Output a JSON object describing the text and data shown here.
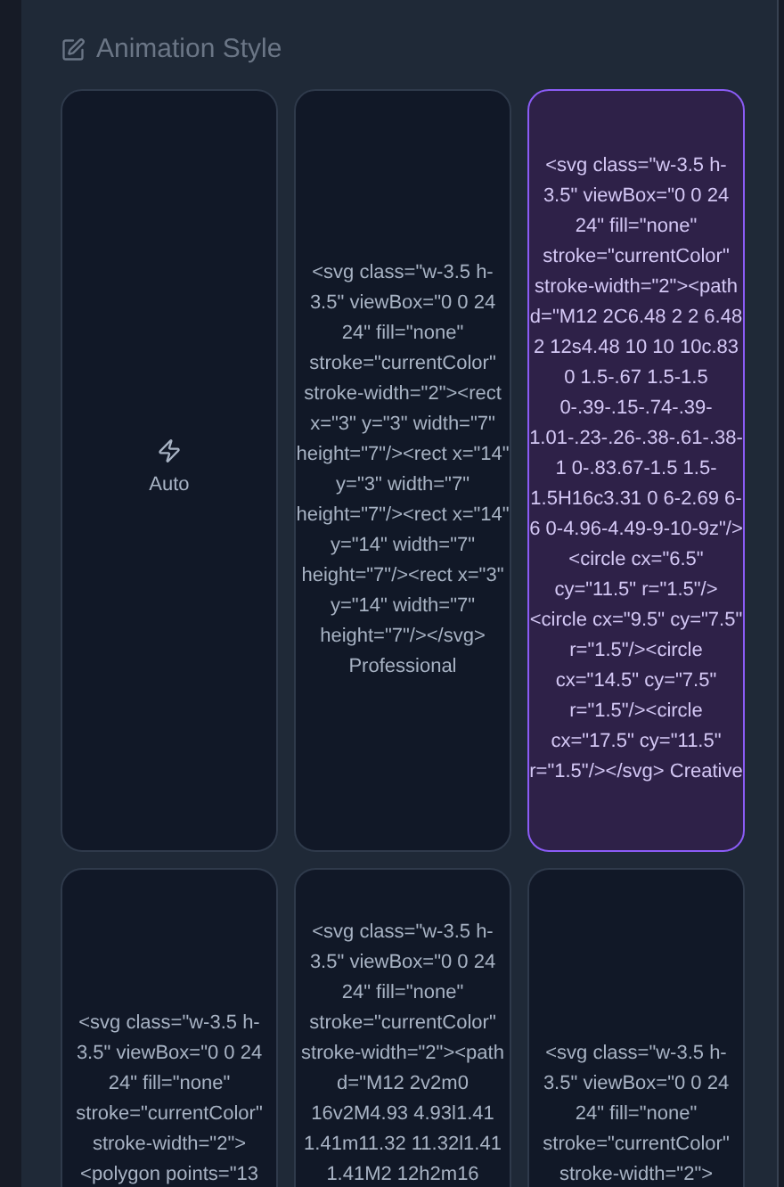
{
  "section": {
    "title": "Animation Style"
  },
  "options": [
    {
      "kind": "icon",
      "label": "Auto",
      "selected": false
    },
    {
      "kind": "markup",
      "text": "<svg class=\"w-3.5 h-3.5\" viewBox=\"0 0 24 24\" fill=\"none\" stroke=\"currentColor\" stroke-width=\"2\"><rect x=\"3\" y=\"3\" width=\"7\" height=\"7\"/><rect x=\"14\" y=\"3\" width=\"7\" height=\"7\"/><rect x=\"14\" y=\"14\" width=\"7\" height=\"7\"/><rect x=\"3\" y=\"14\" width=\"7\" height=\"7\"/></svg> Professional",
      "selected": false
    },
    {
      "kind": "markup",
      "text": "<svg class=\"w-3.5 h-3.5\" viewBox=\"0 0 24 24\" fill=\"none\" stroke=\"currentColor\" stroke-width=\"2\"><path d=\"M12 2C6.48 2 2 6.48 2 12s4.48 10 10 10c.83 0 1.5-.67 1.5-1.5 0-.39-.15-.74-.39-1.01-.23-.26-.38-.61-.38-1 0-.83.67-1.5 1.5-1.5H16c3.31 0 6-2.69 6-6 0-4.96-4.49-9-10-9z\"/><circle cx=\"6.5\" cy=\"11.5\" r=\"1.5\"/><circle cx=\"9.5\" cy=\"7.5\" r=\"1.5\"/><circle cx=\"14.5\" cy=\"7.5\" r=\"1.5\"/><circle cx=\"17.5\" cy=\"11.5\" r=\"1.5\"/></svg> Creative",
      "selected": true
    },
    {
      "kind": "markup",
      "text": "<svg class=\"w-3.5 h-3.5\" viewBox=\"0 0 24 24\" fill=\"none\" stroke=\"currentColor\" stroke-width=\"2\"><polygon points=\"13",
      "selected": false
    },
    {
      "kind": "markup",
      "text": "<svg class=\"w-3.5 h-3.5\" viewBox=\"0 0 24 24\" fill=\"none\" stroke=\"currentColor\" stroke-width=\"2\"><path d=\"M12 2v2m0 16v2M4.93 4.93l1.41 1.41m11.32 11.32l1.41 1.41M2 12h2m16",
      "selected": false
    },
    {
      "kind": "markup",
      "text": "<svg class=\"w-3.5 h-3.5\" viewBox=\"0 0 24 24\" fill=\"none\" stroke=\"currentColor\" stroke-width=\"2\">",
      "selected": false
    }
  ]
}
